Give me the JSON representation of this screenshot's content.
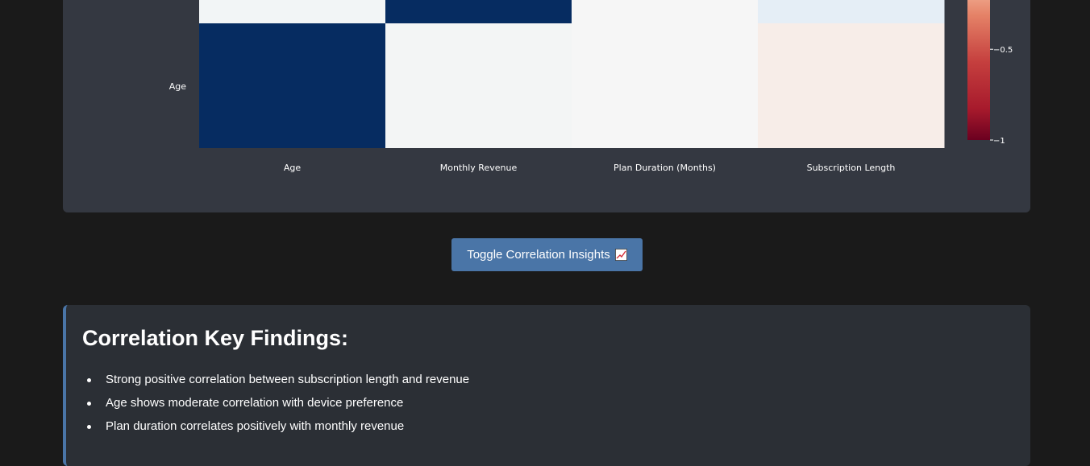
{
  "chart_data": {
    "type": "heatmap",
    "x_labels": [
      "Age",
      "Monthly Revenue",
      "Plan Duration (Months)",
      "Subscription Length"
    ],
    "visible_y_labels": [
      "Age"
    ],
    "visible_rows": [
      {
        "label": "",
        "values": [
          0.03,
          1.0,
          0.0,
          -0.06
        ],
        "colors": [
          "#f2f5f6",
          "#062c61",
          "#f6f6f6",
          "#e5eef6"
        ]
      },
      {
        "label": "Age",
        "values": [
          1.0,
          0.02,
          0.0,
          -0.04
        ],
        "colors": [
          "#062c61",
          "#f3f5f5",
          "#f6f6f6",
          "#f7ede8"
        ]
      }
    ],
    "colorscale": "RdBu",
    "zmin": -1,
    "zmax": 1,
    "colorbar_ticks": [
      {
        "value": -0.5,
        "label": "−0.5"
      },
      {
        "value": -1,
        "label": "−1"
      }
    ]
  },
  "toggle_button": {
    "label": "Toggle Correlation Insights",
    "icon": "chart-increasing-icon"
  },
  "findings": {
    "title": "Correlation Key Findings:",
    "items": [
      "Strong positive correlation between subscription length and revenue",
      "Age shows moderate correlation with device preference",
      "Plan duration correlates positively with monthly revenue"
    ]
  },
  "colors": {
    "page_bg": "#1a1a1a",
    "card_bg": "#343841",
    "findings_bg": "#2b2f35",
    "accent": "#4a75a7"
  }
}
